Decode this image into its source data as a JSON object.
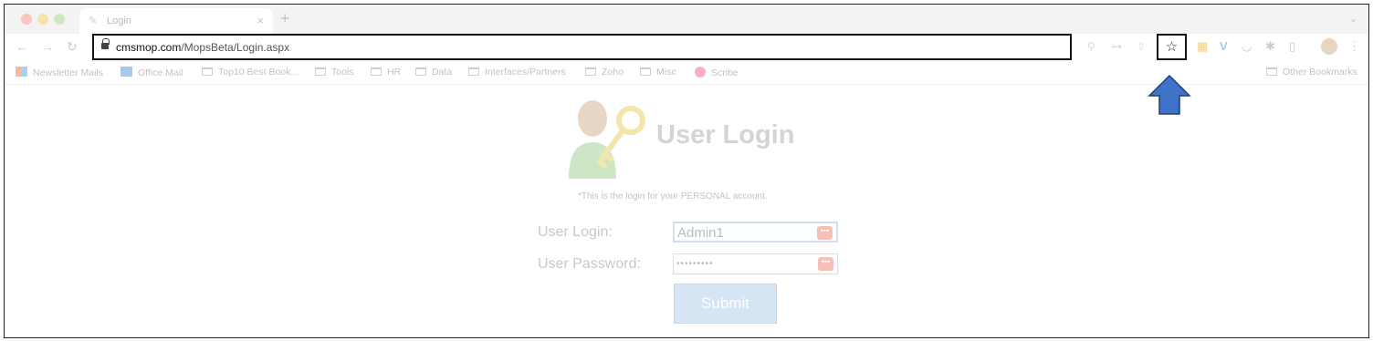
{
  "tab": {
    "title": "Login"
  },
  "toolbar": {
    "url_host": "cmsmop.com",
    "url_path": "/MopsBeta/Login.aspx"
  },
  "bookmarks": [
    {
      "label": "Newsletter Mails",
      "icon": "grid-icon"
    },
    {
      "label": "Office Mail",
      "icon": "mail-icon"
    },
    {
      "label": "Top10 Best Book...",
      "icon": "folder-icon"
    },
    {
      "label": "Tools",
      "icon": "folder-icon"
    },
    {
      "label": "HR",
      "icon": "folder-icon"
    },
    {
      "label": "Data",
      "icon": "folder-icon"
    },
    {
      "label": "Interfaces/Partners",
      "icon": "folder-icon"
    },
    {
      "label": "Zoho",
      "icon": "folder-icon"
    },
    {
      "label": "Misc",
      "icon": "folder-icon"
    },
    {
      "label": "Scribe",
      "icon": "scribe-icon"
    }
  ],
  "other_bookmarks": "Other Bookmarks",
  "login": {
    "title": "User Login",
    "note": "*This is the login for your PERSONAL account.",
    "user_label": "User Login:",
    "password_label": "User Password:",
    "user_value": "Admin1",
    "password_value": "•••••••••",
    "submit_label": "Submit"
  },
  "colors": {
    "arrow_fill": "#3f73c8",
    "arrow_stroke": "#1b3d7a"
  }
}
